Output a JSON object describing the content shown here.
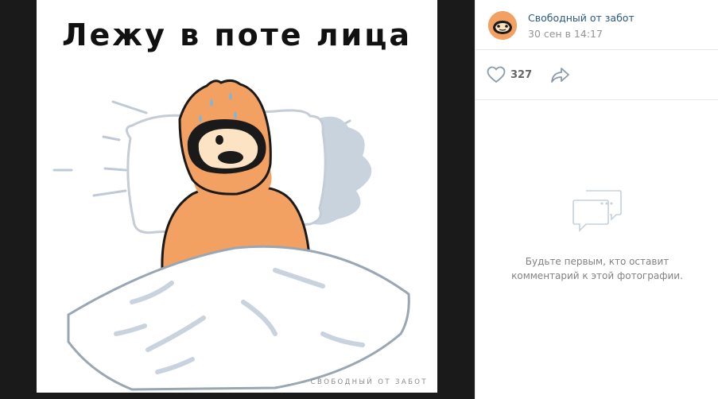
{
  "photo": {
    "caption": "Лежу в поте лица",
    "watermark": "Свободный от забот"
  },
  "post": {
    "author": "Свободный от забот",
    "date": "30 сен в 14:17",
    "likes": "327"
  },
  "comments": {
    "empty_text_line1": "Будьте первым, кто оставит",
    "empty_text_line2": "комментарий к этой фотографии."
  },
  "icons": {
    "like": "heart-outline-icon",
    "share": "share-arrow-icon",
    "comments": "speech-bubbles-icon"
  },
  "colors": {
    "link": "#2a5885",
    "muted": "#939393",
    "sloth_fur": "#f3a063"
  }
}
